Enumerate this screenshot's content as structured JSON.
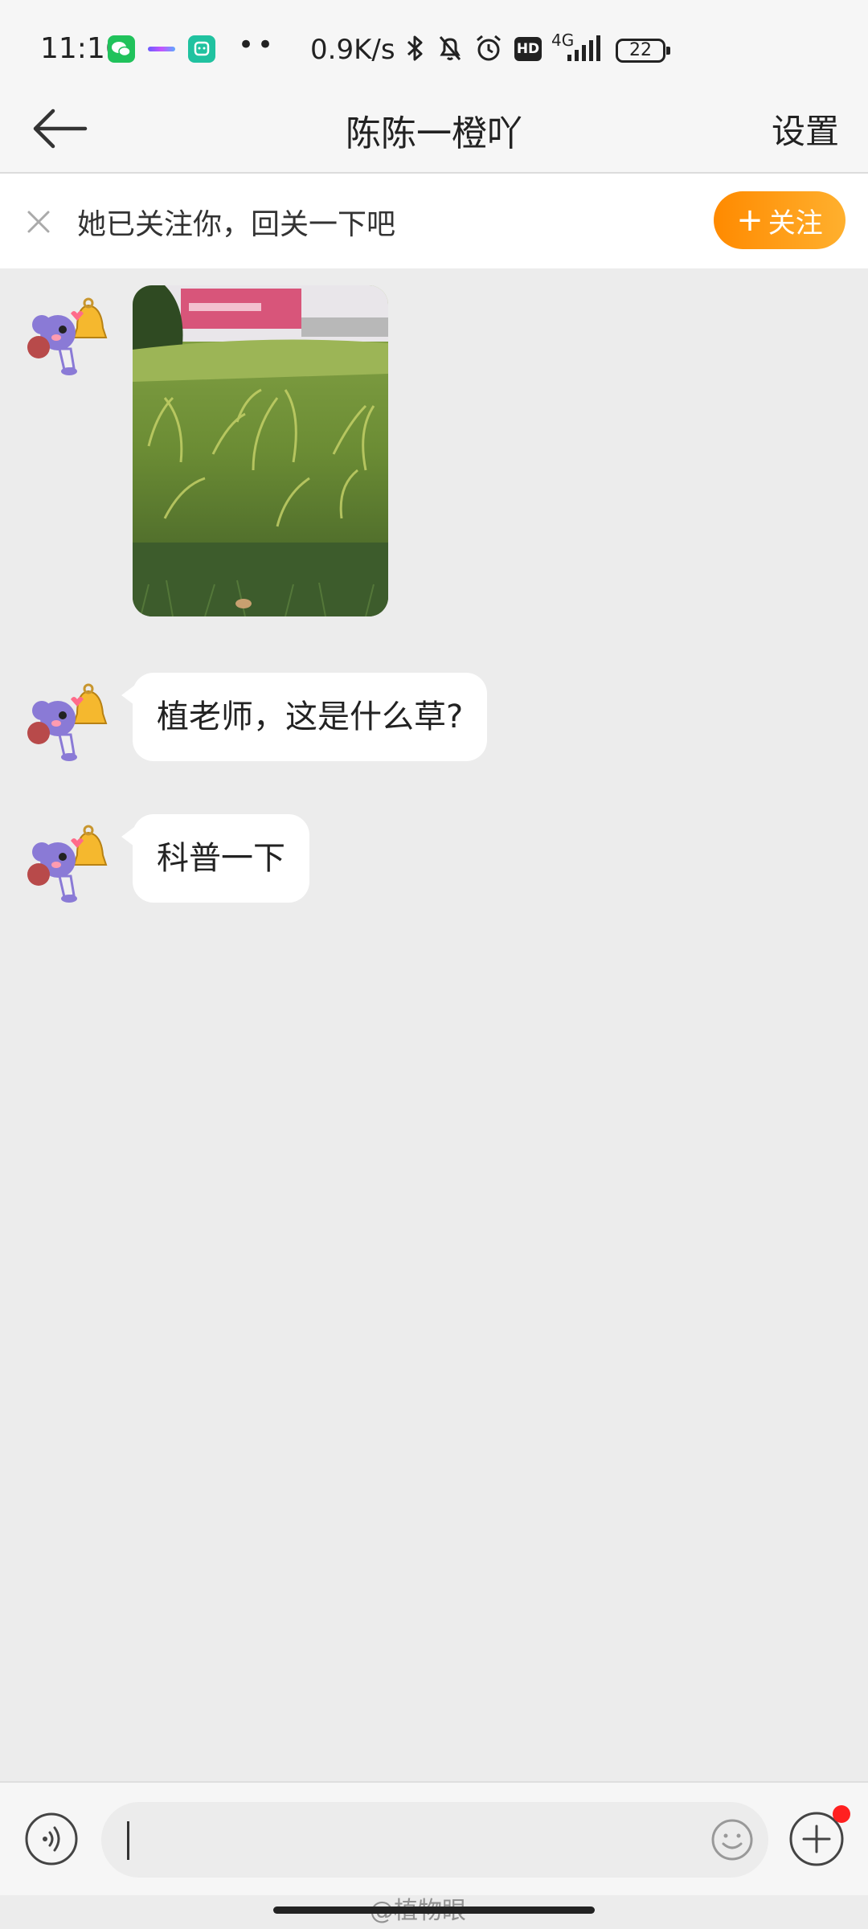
{
  "status_bar": {
    "time": "11:16",
    "dots": "••",
    "net_speed": "0.9K/s",
    "hd": "HD",
    "network": "4G",
    "battery": "22",
    "icons": [
      "wechat-icon",
      "swirl-app-icon",
      "mi-app-icon",
      "bluetooth-icon",
      "mute-bell-icon",
      "alarm-icon",
      "hd-icon",
      "signal-icon",
      "battery-icon"
    ]
  },
  "header": {
    "title": "陈陈一橙吖",
    "settings_label": "设置"
  },
  "banner": {
    "text": "她已关注你，回关一下吧",
    "follow_plus": "+",
    "follow_label": "关注"
  },
  "messages": [
    {
      "type": "image",
      "description": "photo"
    },
    {
      "type": "text",
      "text": "植老师，这是什么草?"
    },
    {
      "type": "text",
      "text": "科普一下"
    }
  ],
  "watermark": "@植物眼",
  "colors": {
    "accent": "#ff9a1a",
    "background": "#ececec",
    "badge": "#ff2020"
  }
}
